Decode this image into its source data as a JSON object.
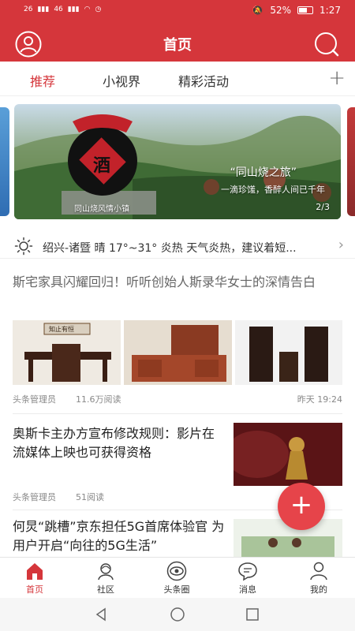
{
  "status_bar": {
    "signal_left": "26",
    "signal_right": "46",
    "battery": "52%",
    "time": "1:27"
  },
  "header": {
    "title": "首页",
    "left_icon": "user-icon",
    "right_icon": "search-icon"
  },
  "tabs": [
    {
      "label": "推荐",
      "active": true
    },
    {
      "label": "小视界",
      "active": false
    },
    {
      "label": "精彩活动",
      "active": false
    }
  ],
  "tabs_add_label": "+",
  "banner": {
    "jar_label": "酒",
    "title": "“同山烧之旅”",
    "subtitle": "一滴珍馐，香醉人间已千年",
    "caption": "同山烧风情小镇",
    "page": "2/3"
  },
  "weather": {
    "icon": "sun-icon",
    "text": "绍兴-诸暨 晴 17°~31° 炎热 天气炎热，建议着短..."
  },
  "articles": [
    {
      "title": "斯宅家具闪耀回归！听听创始人斯录华女士的深情告白",
      "source": "头条管理员",
      "reads": "11.6万阅读",
      "time": "昨天 19:24",
      "plaque_text": "知止有恒"
    },
    {
      "title": "奥斯卡主办方宣布修改规则：影片在流媒体上映也可获得资格",
      "source": "头条管理员",
      "reads": "51阅读"
    },
    {
      "title": "何炅“跳槽”京东担任5G首席体验官 为用户开启“向往的5G生活”"
    }
  ],
  "fab_label": "+",
  "bottom_nav": [
    {
      "label": "首页",
      "icon": "home-icon",
      "active": true
    },
    {
      "label": "社区",
      "icon": "community-icon",
      "active": false
    },
    {
      "label": "头条圈",
      "icon": "eye-circle-icon",
      "active": false
    },
    {
      "label": "消息",
      "icon": "message-icon",
      "active": false
    },
    {
      "label": "我的",
      "icon": "profile-icon",
      "active": false
    }
  ],
  "colors": {
    "brand": "#d5363b",
    "fab": "#e6444a"
  }
}
